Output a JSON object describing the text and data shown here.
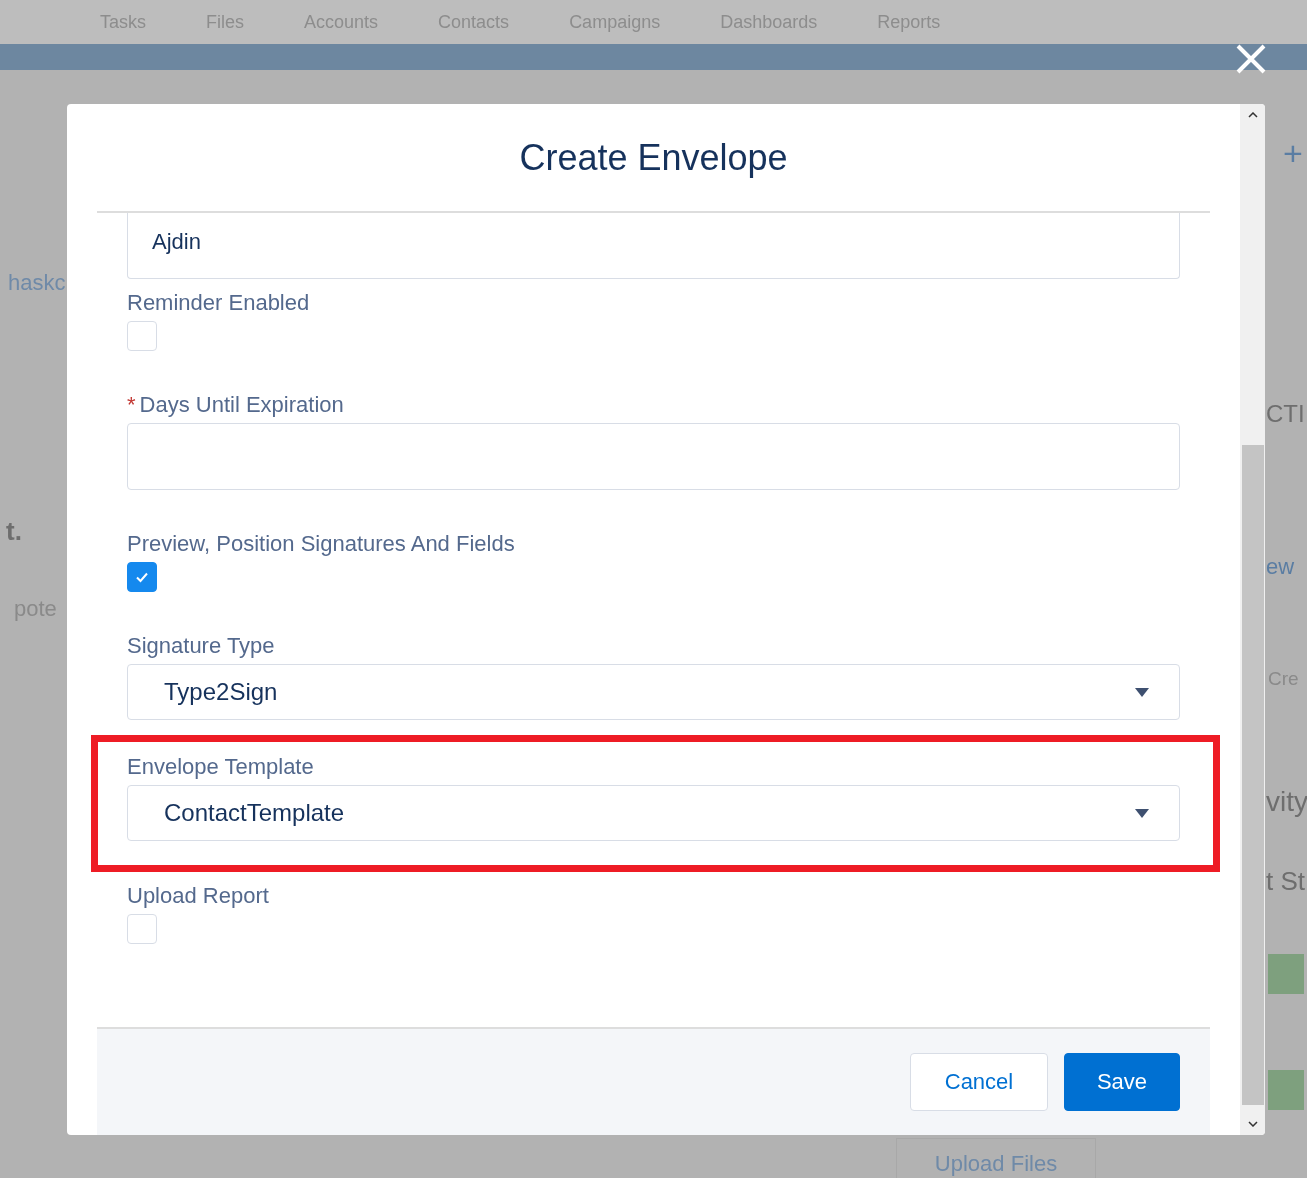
{
  "nav": {
    "items": [
      {
        "label": "Tasks"
      },
      {
        "label": "Files"
      },
      {
        "label": "Accounts"
      },
      {
        "label": "Contacts"
      },
      {
        "label": "Campaigns"
      },
      {
        "label": "Dashboards"
      },
      {
        "label": "Reports"
      }
    ]
  },
  "background": {
    "left_link": "haskc",
    "left_heading": "t.",
    "left_text": "pote",
    "plus": "+",
    "right_tab": "CTI",
    "right_link": "ew",
    "right_button": "Cre",
    "right_heading": "vity",
    "right_subheading": "t St",
    "upload_button": "Upload Files"
  },
  "modal": {
    "title": "Create Envelope",
    "fields": [
      {
        "kind": "textarea",
        "value": "Ajdin"
      },
      {
        "kind": "checkbox",
        "label": "Reminder Enabled",
        "checked": false
      },
      {
        "kind": "input",
        "label": "Days Until Expiration",
        "required_mark": "*"
      },
      {
        "kind": "checkbox",
        "label": "Preview, Position Signatures And Fields",
        "checked": true
      },
      {
        "kind": "select",
        "label": "Signature Type",
        "value": "Type2Sign",
        "highlighted": false
      },
      {
        "kind": "select",
        "label": "Envelope Template",
        "value": "ContactTemplate",
        "highlighted": true
      },
      {
        "kind": "checkbox",
        "label": "Upload Report",
        "checked": false
      }
    ],
    "buttons": [
      {
        "label": "Cancel",
        "kind": "neutral"
      },
      {
        "label": "Save",
        "kind": "brand"
      }
    ]
  }
}
